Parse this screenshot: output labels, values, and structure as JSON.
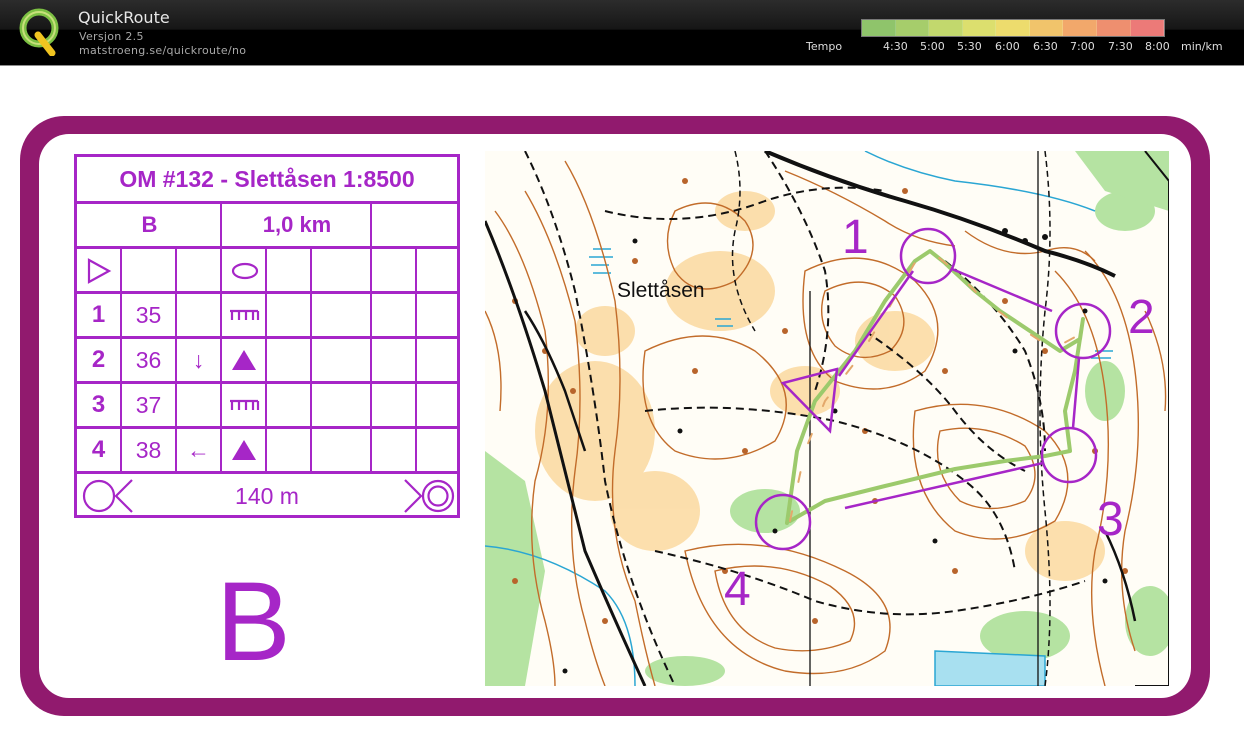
{
  "header": {
    "app_name": "QuickRoute",
    "version": "Versjon 2.5",
    "url": "matstroeng.se/quickroute/no",
    "logo_letter": "Q",
    "tempo_label": "Tempo",
    "tempo_ticks": [
      "4:30",
      "5:00",
      "5:30",
      "6:00",
      "6:30",
      "7:00",
      "7:30",
      "8:00"
    ],
    "tempo_unit": "min/km",
    "legend_colors": [
      "#8fc46b",
      "#a6cd6b",
      "#c2d86d",
      "#dcdf6e",
      "#eddc6d",
      "#f1c46b",
      "#f2a86b",
      "#ee8f6f",
      "#ec7a78"
    ]
  },
  "description": {
    "title": "OM #132 - Slettåsen 1:8500",
    "class_letter": "B",
    "distance": "1,0 km",
    "controls": [
      {
        "num": "1",
        "code": "35",
        "symbol": "rootstock"
      },
      {
        "num": "2",
        "code": "36",
        "direction": "↓",
        "symbol": "triangle"
      },
      {
        "num": "3",
        "code": "37",
        "symbol": "rootstock"
      },
      {
        "num": "4",
        "code": "38",
        "direction": "←",
        "symbol": "triangle"
      }
    ],
    "finish_distance": "140 m"
  },
  "map": {
    "place_name": "Slettåsen",
    "control_labels": [
      "1",
      "2",
      "3",
      "4"
    ],
    "course_color": "#a626c7",
    "frame_color": "#911a6e"
  },
  "course_letter": "B"
}
